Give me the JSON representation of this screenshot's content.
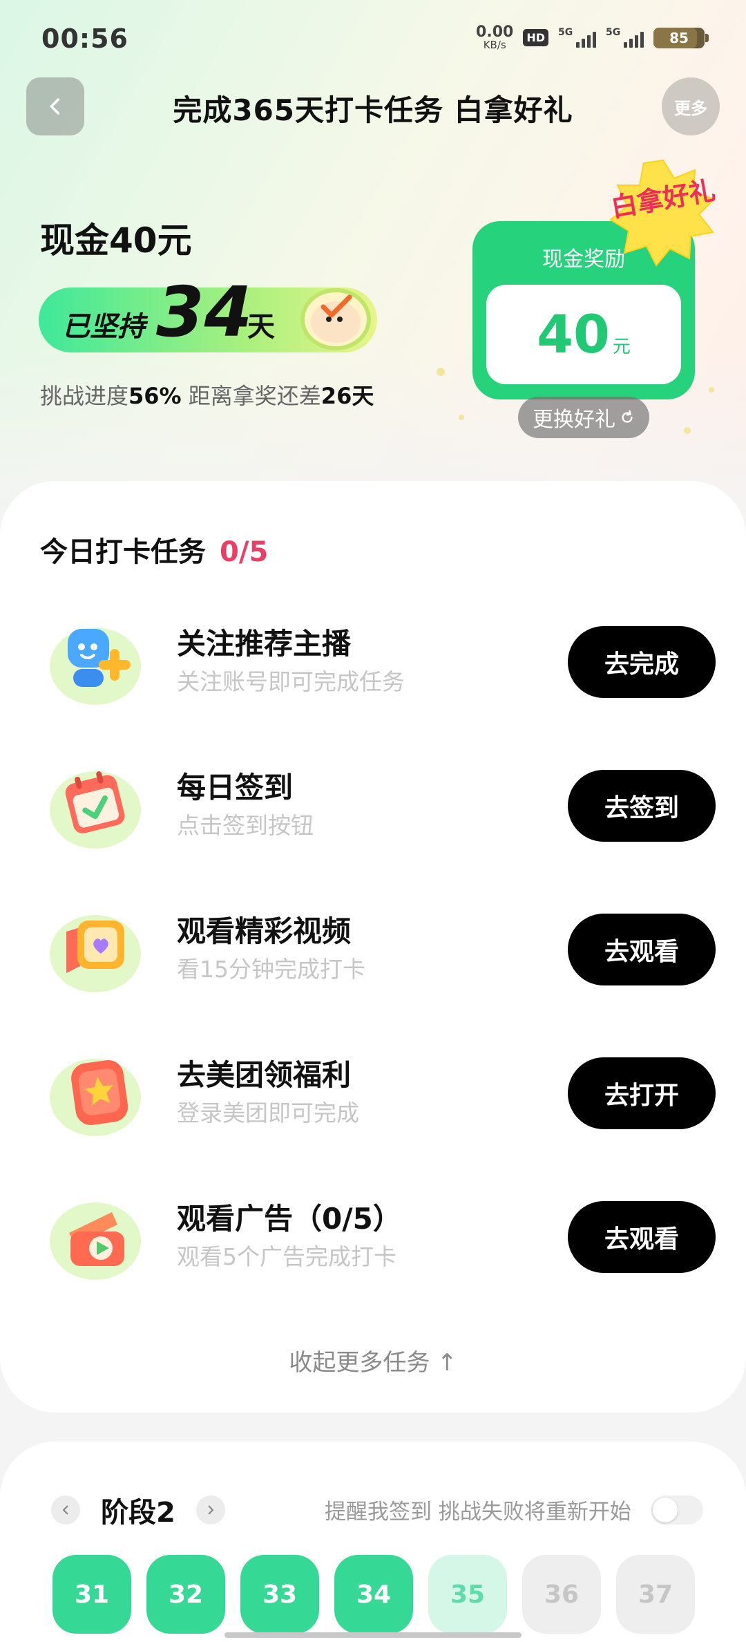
{
  "status_bar": {
    "time": "00:56",
    "net_speed_value": "0.00",
    "net_speed_unit": "KB/s",
    "hd_badge": "HD",
    "sim1_label": "5G",
    "sim2_label": "5G",
    "battery": "85",
    "battery_level": 0.85
  },
  "nav": {
    "title": "完成365天打卡任务 白拿好礼",
    "more_label": "更多"
  },
  "hero": {
    "cash_title": "现金40元",
    "streak_prefix": "已坚持",
    "streak_days": "34",
    "streak_unit": "天",
    "progress_label": "挑战进度",
    "progress_value": "56%",
    "remaining_label": "距离拿奖还差",
    "remaining_value": "26天",
    "reward_label": "现金奖励",
    "reward_value": "40",
    "reward_unit": "元",
    "gift_badge": "白拿好礼",
    "swap_label": "更换好礼"
  },
  "tasks": {
    "header": "今日打卡任务",
    "count": "0/5",
    "items": [
      {
        "title": "关注推荐主播",
        "desc": "关注账号即可完成任务",
        "button": "去完成",
        "icon": "follow-anchor-icon"
      },
      {
        "title": "每日签到",
        "desc": "点击签到按钮",
        "button": "去签到",
        "icon": "calendar-check-icon"
      },
      {
        "title": "观看精彩视频",
        "desc": "看15分钟完成打卡",
        "button": "去观看",
        "icon": "video-heart-icon"
      },
      {
        "title": "去美团领福利",
        "desc": "登录美团即可完成",
        "button": "去打开",
        "icon": "meituan-star-icon"
      },
      {
        "title": "观看广告（0/5）",
        "desc": "观看5个广告完成打卡",
        "button": "去观看",
        "icon": "ad-play-icon"
      }
    ],
    "collapse_label": "收起更多任务 ↑"
  },
  "stage": {
    "title": "阶段2",
    "remind_text": "提醒我签到 挑战失败将重新开始",
    "remind_enabled": false,
    "days": [
      {
        "label": "31",
        "state": "done"
      },
      {
        "label": "32",
        "state": "done"
      },
      {
        "label": "33",
        "state": "done"
      },
      {
        "label": "34",
        "state": "done"
      },
      {
        "label": "35",
        "state": "current"
      },
      {
        "label": "36",
        "state": "future"
      },
      {
        "label": "37",
        "state": "future"
      }
    ]
  },
  "colors": {
    "accent_green": "#26d37c",
    "count_red": "#ee3d65",
    "badge_red": "#ef2d56"
  }
}
